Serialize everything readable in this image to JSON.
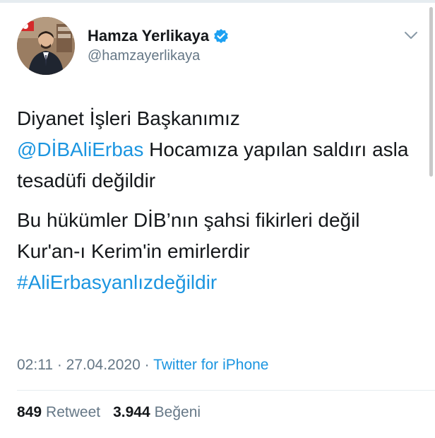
{
  "author": {
    "display_name": "Hamza Yerlikaya",
    "handle": "@hamzayerlikaya",
    "verified": true
  },
  "tweet": {
    "line1": "Diyanet İşleri Başkanımız",
    "mention": "@DİBAliErbas",
    "line2_rest": " Hocamıza yapılan saldırı asla tesadüfi değildir",
    "para2": "Bu hükümler DİB’nın şahsi fikirleri değil Kur'an-ı Kerim'in emirlerdir",
    "hashtag": "#AliErbasyanlızdeğildir"
  },
  "meta": {
    "time": "02:11",
    "separator1": " · ",
    "date": "27.04.2020",
    "separator2": " · ",
    "source": "Twitter for iPhone"
  },
  "stats": {
    "retweet_count": "849",
    "retweet_label": "Retweet",
    "like_count": "3.944",
    "like_label": "Beğeni"
  },
  "colors": {
    "link": "#1b95e0",
    "secondary_text": "#657786",
    "verified_badge": "#1da1f2"
  },
  "icons": {
    "verified": "verified-badge-icon",
    "menu": "chevron-down-icon"
  }
}
